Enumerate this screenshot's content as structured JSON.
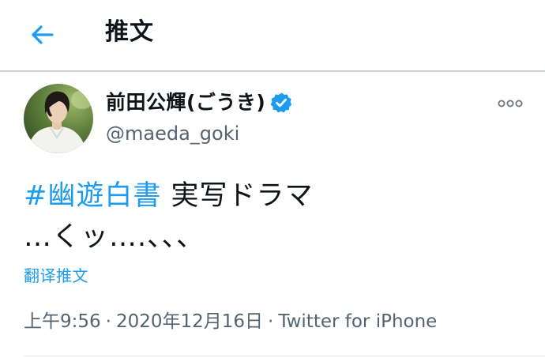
{
  "header": {
    "title": "推文",
    "back_icon": "arrow-left-icon"
  },
  "author": {
    "display_name": "前田公輝(ごうき)",
    "handle": "@maeda_goki",
    "verified_icon": "verified-badge-icon",
    "more_icon": "more-horizontal-icon"
  },
  "tweet": {
    "hashtag": "#幽遊白書",
    "line1_rest": " 実写ドラマ",
    "line2": "…くッ….、、、",
    "translate_label": "翻译推文"
  },
  "meta": {
    "time": "上午9:56",
    "separator": "·",
    "date": "2020年12月16日",
    "source": "Twitter for iPhone"
  },
  "colors": {
    "accent": "#1d9bf0",
    "text": "#0f1419",
    "muted": "#536471",
    "divider": "#c9d3da"
  }
}
